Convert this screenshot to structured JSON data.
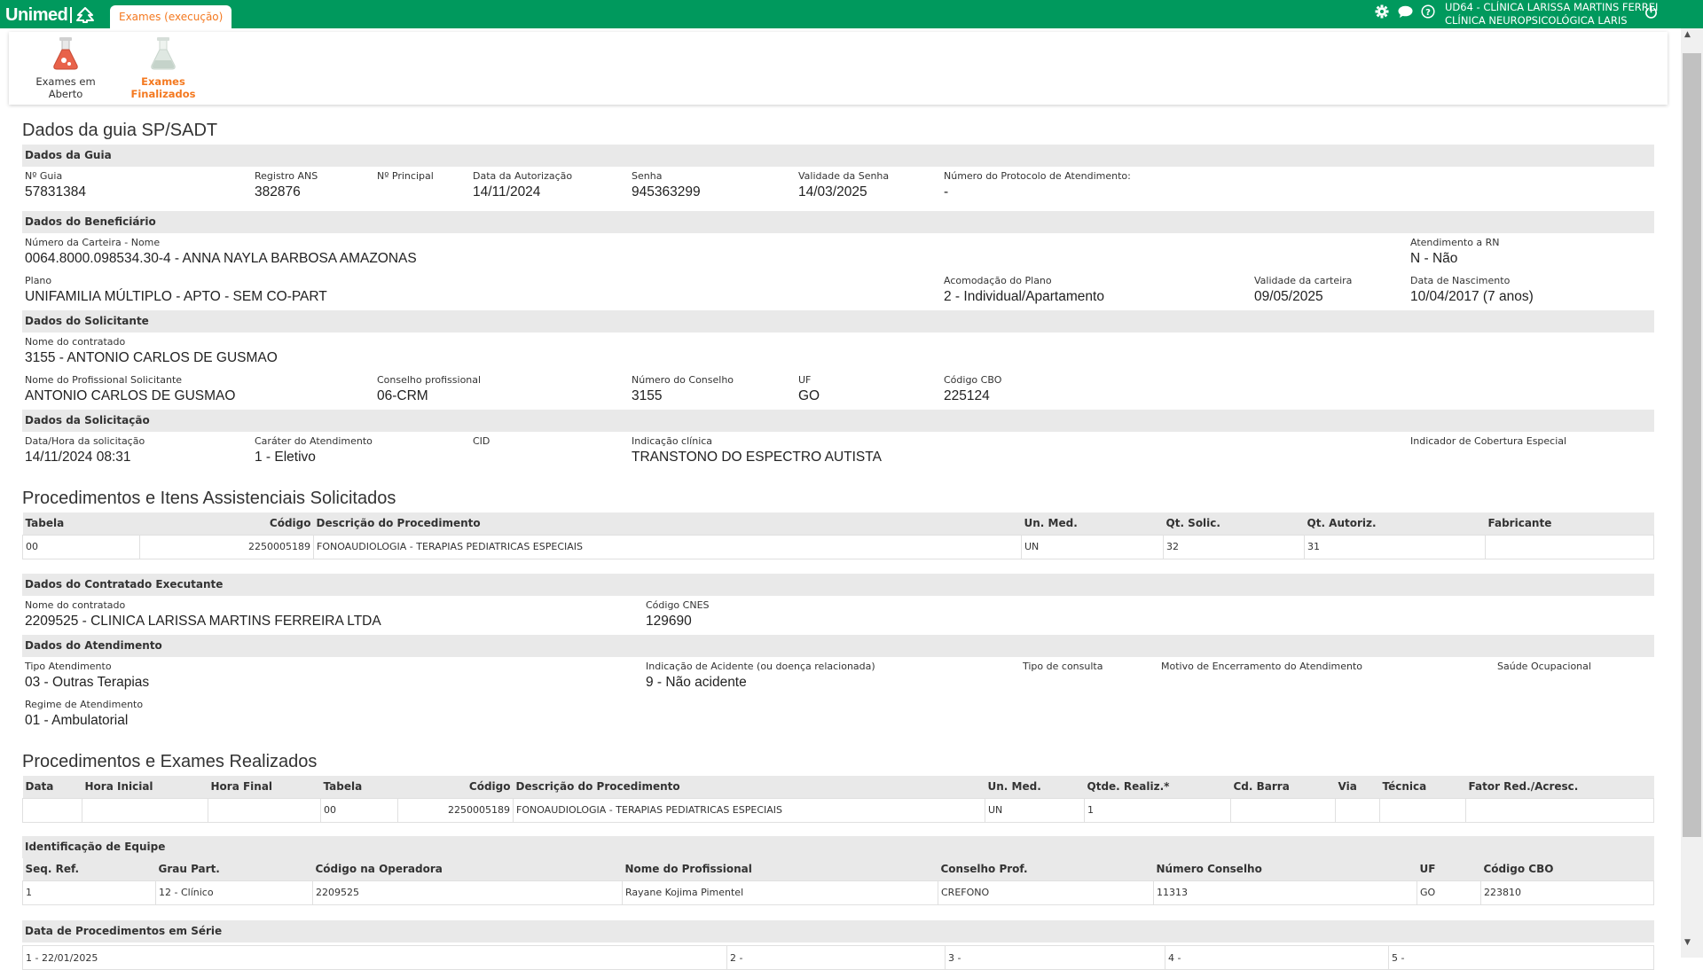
{
  "app": {
    "brand": "Unimed",
    "active_tab": "Exames (execução)",
    "user_line1": "UD64 - CLÍNICA LARISSA MARTINS FERREI",
    "user_line2": "CLÍNICA NEUROPSICOLÓGICA LARIS"
  },
  "toolbar": {
    "aberto_line1": "Exames em",
    "aberto_line2": "Aberto",
    "finalizados_line1": "Exames",
    "finalizados_line2": "Finalizados"
  },
  "guia": {
    "title": "Dados da guia SP/SADT",
    "sec_guia": "Dados da Guia",
    "fields": [
      {
        "label": "Nº Guia",
        "value": "57831384"
      },
      {
        "label": "Registro ANS",
        "value": "382876"
      },
      {
        "label": "Nº Principal",
        "value": ""
      },
      {
        "label": "Data da Autorização",
        "value": "14/11/2024"
      },
      {
        "label": "Senha",
        "value": "945363299"
      },
      {
        "label": "Validade da Senha",
        "value": "14/03/2025"
      },
      {
        "label": "Número do Protocolo de Atendimento:",
        "value": "-"
      }
    ]
  },
  "beneficiario": {
    "section": "Dados do Beneficiário",
    "carteira_label": "Número da Carteira - Nome",
    "carteira_value": "0064.8000.098534.30-4 - ANNA NAYLA BARBOSA AMAZONAS",
    "rn_label": "Atendimento a RN",
    "rn_value": "N - Não",
    "plano_label": "Plano",
    "plano_value": "UNIFAMILIA MÚLTIPLO - APTO - SEM CO-PART",
    "acomodacao_label": "Acomodação do Plano",
    "acomodacao_value": "2 - Individual/Apartamento",
    "validade_label": "Validade da carteira",
    "validade_value": "09/05/2025",
    "nascimento_label": "Data de Nascimento",
    "nascimento_value": "10/04/2017 (7 anos)"
  },
  "solicitante": {
    "section": "Dados do Solicitante",
    "contratado_label": "Nome do contratado",
    "contratado_value": "3155 - ANTONIO CARLOS DE GUSMAO",
    "fields": [
      {
        "label": "Nome do Profissional Solicitante",
        "value": "ANTONIO CARLOS DE GUSMAO"
      },
      {
        "label": "Conselho profissional",
        "value": "06-CRM"
      },
      {
        "label": "Número do Conselho",
        "value": "3155"
      },
      {
        "label": "UF",
        "value": "GO"
      },
      {
        "label": "Código CBO",
        "value": "225124"
      }
    ]
  },
  "solicitacao": {
    "section": "Dados da Solicitação",
    "fields": [
      {
        "label": "Data/Hora da solicitação",
        "value": "14/11/2024 08:31"
      },
      {
        "label": "Caráter do Atendimento",
        "value": "1 - Eletivo"
      },
      {
        "label": "CID",
        "value": ""
      },
      {
        "label": "Indicação clínica",
        "value": "TRANSTONO DO ESPECTRO AUTISTA"
      },
      {
        "label": "Indicador de Cobertura Especial",
        "value": ""
      }
    ]
  },
  "proc_solicitados": {
    "title": "Procedimentos e Itens Assistenciais Solicitados",
    "headers": [
      "Tabela",
      "Código",
      "Descrição do Procedimento",
      "Un. Med.",
      "Qt. Solic.",
      "Qt. Autoriz.",
      "Fabricante"
    ],
    "rows": [
      [
        "00",
        "2250005189",
        "FONOAUDIOLOGIA - TERAPIAS PEDIATRICAS ESPECIAIS",
        "UN",
        "32",
        "31",
        ""
      ]
    ]
  },
  "executante": {
    "section": "Dados do Contratado Executante",
    "nome_label": "Nome do contratado",
    "nome_value": "2209525 - CLINICA LARISSA MARTINS FERREIRA LTDA",
    "cnes_label": "Código CNES",
    "cnes_value": "129690"
  },
  "atendimento": {
    "section": "Dados do Atendimento",
    "fields": [
      {
        "label": "Tipo Atendimento",
        "value": "03 - Outras Terapias"
      },
      {
        "label": "Indicação de Acidente (ou doença relacionada)",
        "value": "9 - Não acidente"
      },
      {
        "label": "Tipo de consulta",
        "value": ""
      },
      {
        "label": "Motivo de Encerramento do Atendimento",
        "value": ""
      },
      {
        "label": "Saúde Ocupacional",
        "value": ""
      }
    ],
    "regime_label": "Regime de Atendimento",
    "regime_value": "01 - Ambulatorial"
  },
  "proc_realizados": {
    "title": "Procedimentos e Exames Realizados",
    "headers": [
      "Data",
      "Hora Inicial",
      "Hora Final",
      "Tabela",
      "Código",
      "Descrição do Procedimento",
      "Un. Med.",
      "Qtde. Realiz.*",
      "Cd. Barra",
      "Via",
      "Técnica",
      "Fator Red./Acresc."
    ],
    "rows": [
      [
        "",
        "",
        "",
        "00",
        "2250005189",
        "FONOAUDIOLOGIA - TERAPIAS PEDIATRICAS ESPECIAIS",
        "UN",
        "1",
        "",
        "",
        "",
        ""
      ]
    ]
  },
  "equipe": {
    "section": "Identificação de Equipe",
    "headers": [
      "Seq. Ref.",
      "Grau Part.",
      "Código na Operadora",
      "Nome do Profissional",
      "Conselho Prof.",
      "Número Conselho",
      "UF",
      "Código CBO"
    ],
    "rows": [
      [
        "1",
        "12 - Clínico",
        "2209525",
        "Rayane Kojima Pimentel",
        "CREFONO",
        "11313",
        "GO",
        "223810"
      ]
    ]
  },
  "serie": {
    "section": "Data de Procedimentos em Série",
    "items": [
      "1 - 22/01/2025",
      "2 -",
      "3 -",
      "4 -",
      "5 -"
    ]
  }
}
